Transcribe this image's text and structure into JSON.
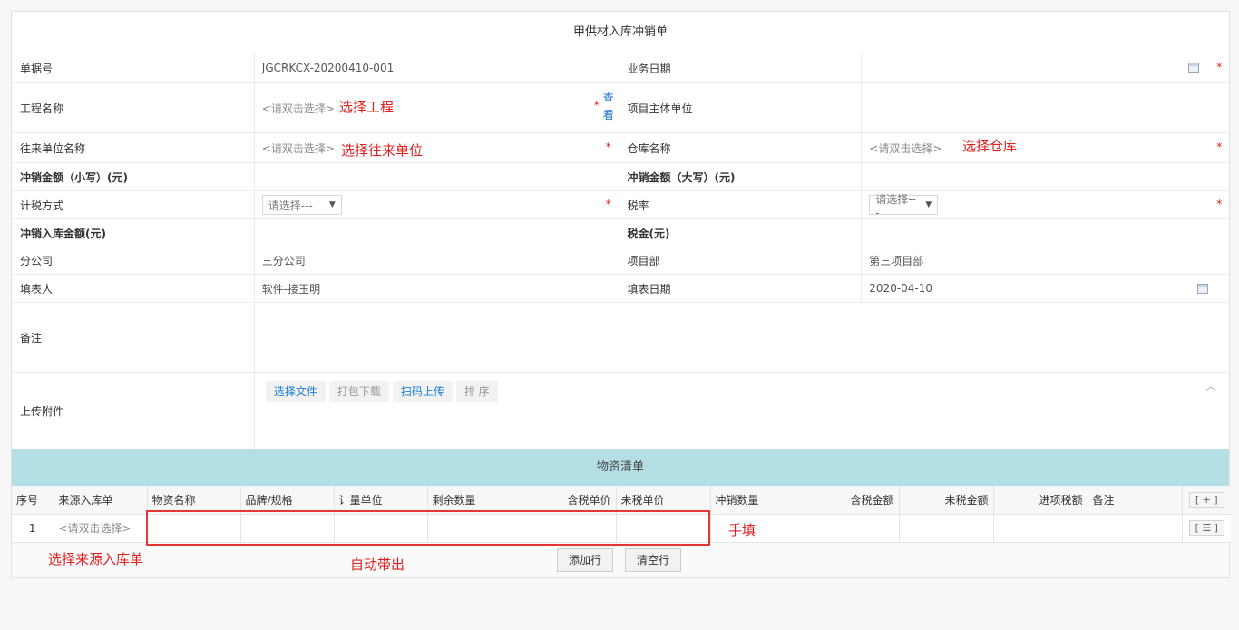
{
  "title": "甲供材入库冲销单",
  "fields": {
    "doc_no_label": "单据号",
    "doc_no_value": "JGCRKCX-20200410-001",
    "biz_date_label": "业务日期",
    "project_label": "工程名称",
    "project_placeholder": "<请双击选择>",
    "project_view": "查看",
    "project_owner_label": "项目主体单位",
    "partner_label": "往来单位名称",
    "partner_placeholder": "<请双击选择>",
    "warehouse_label": "仓库名称",
    "warehouse_placeholder": "<请双击选择>",
    "amount_small_label": "冲销金额（小写）(元)",
    "amount_big_label": "冲销金额（大写）(元)",
    "tax_method_label": "计税方式",
    "tax_method_value": "请选择---",
    "tax_rate_label": "税率",
    "tax_rate_value": "请选择---",
    "in_amount_label": "冲销入库金额(元)",
    "tax_label": "税金(元)",
    "branch_label": "分公司",
    "branch_value": "三分公司",
    "dept_label": "项目部",
    "dept_value": "第三项目部",
    "filler_label": "填表人",
    "filler_value": "软件-接玉明",
    "fill_date_label": "填表日期",
    "fill_date_value": "2020-04-10",
    "remark_label": "备注",
    "attach_label": "上传附件",
    "required_mark": "*"
  },
  "upload_buttons": [
    "选择文件",
    "打包下载",
    "扫码上传",
    "排 序"
  ],
  "collapse_icon": "︿",
  "materials": {
    "header": "物资清单",
    "columns": [
      "序号",
      "来源入库单",
      "物资名称",
      "品牌/规格",
      "计量单位",
      "剩余数量",
      "含税单价",
      "未税单价",
      "冲销数量",
      "含税金额",
      "未税金额",
      "进项税额",
      "备注"
    ],
    "add_row_icon": "[ + ]",
    "row_menu_icon": "[ ☰ ]",
    "rows": [
      {
        "no": "1",
        "source": "<请双击选择>"
      }
    ],
    "add_button": "添加行",
    "clear_button": "清空行"
  },
  "annotations": {
    "select_project": "选择工程",
    "select_partner": "选择往来单位",
    "select_warehouse": "选择仓库",
    "manual_fill": "手填",
    "select_source": "选择来源入库单",
    "auto_fill": "自动带出"
  },
  "colors": {
    "accent_red": "#e02020",
    "link_blue": "#1a7fd8",
    "table_header": "#b3dfe5"
  }
}
